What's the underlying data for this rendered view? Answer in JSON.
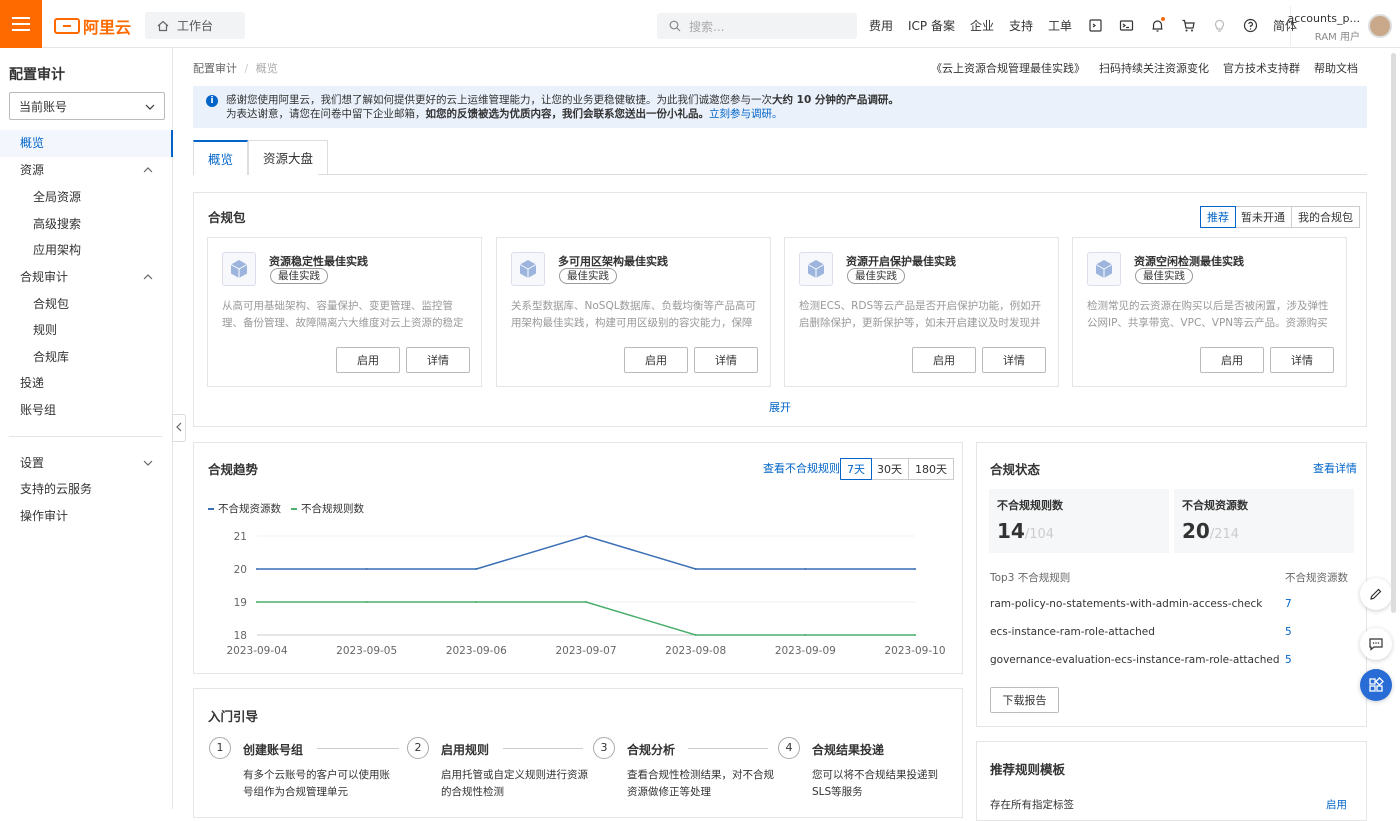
{
  "topbar": {
    "logo": "阿里云",
    "workbench": "工作台",
    "search_placeholder": "搜索...",
    "nav": [
      "费用",
      "ICP 备案",
      "企业",
      "支持",
      "工单"
    ],
    "lang": "简体",
    "account_name": "accounts_p...",
    "account_role": "RAM 用户"
  },
  "sidebar": {
    "title": "配置审计",
    "account_select": "当前账号",
    "items": [
      {
        "label": "概览"
      },
      {
        "label": "资源"
      },
      {
        "label": "全局资源"
      },
      {
        "label": "高级搜索"
      },
      {
        "label": "应用架构"
      },
      {
        "label": "合规审计"
      },
      {
        "label": "合规包"
      },
      {
        "label": "规则"
      },
      {
        "label": "合规库"
      },
      {
        "label": "投递"
      },
      {
        "label": "账号组"
      },
      {
        "label": "设置"
      },
      {
        "label": "支持的云服务"
      },
      {
        "label": "操作审计"
      }
    ]
  },
  "breadcrumb": {
    "root": "配置审计",
    "sep": "/",
    "current": "概览"
  },
  "top_links": [
    "《云上资源合规管理最佳实践》",
    "扫码持续关注资源变化",
    "官方技术支持群",
    "帮助文档"
  ],
  "banner": {
    "line1_a": "感谢您使用阿里云，我们想了解如何提供更好的云上运维管理能力，让您的业务更稳健敏捷。为此我们诚邀您参与一次",
    "line1_b": "大约 10 分钟的产品调研。",
    "line2_a": "为表达谢意，请您在问卷中留下企业邮箱，",
    "line2_b": "如您的反馈被选为优质内容，我们会联系您送出一份小礼品。",
    "line2_link": "立刻参与调研。"
  },
  "tabs": [
    "概览",
    "资源大盘"
  ],
  "compliance_packs": {
    "title": "合规包",
    "filters": [
      "推荐",
      "暂未开通",
      "我的合规包"
    ],
    "cards": [
      {
        "name": "资源稳定性最佳实践",
        "tag": "最佳实践",
        "desc": "从高可用基础架构、容量保护、变更管理、监控管理、备份管理、故障隔离六大维度对云上资源的稳定性做..."
      },
      {
        "name": "多可用区架构最佳实践",
        "tag": "最佳实践",
        "desc": "关系型数据库、NoSQL数据库、负载均衡等产品高可用架构最佳实践，构建可用区级别的容灾能力，保障服..."
      },
      {
        "name": "资源开启保护最佳实践",
        "tag": "最佳实践",
        "desc": "检测ECS、RDS等云产品是否开启保护功能，例如开启删除保护，更新保护等，如未开启建议及时发现并治..."
      },
      {
        "name": "资源空闲检测最佳实践",
        "tag": "最佳实践",
        "desc": "检测常见的云资源在购买以后是否被闲置，涉及弹性公网IP、共享带宽、VPC、VPN等云产品。资源购买后..."
      }
    ],
    "enable_label": "启用",
    "detail_label": "详情",
    "expand": "展开"
  },
  "trend": {
    "title": "合规趋势",
    "link": "查看不合规规则",
    "ranges": [
      "7天",
      "30天",
      "180天"
    ]
  },
  "chart_data": {
    "type": "line",
    "x": [
      "2023-09-04",
      "2023-09-05",
      "2023-09-06",
      "2023-09-07",
      "2023-09-08",
      "2023-09-09",
      "2023-09-10"
    ],
    "series": [
      {
        "name": "不合规资源数",
        "values": [
          20,
          20,
          20,
          21,
          20,
          20,
          20
        ],
        "color": "#3a6fb5"
      },
      {
        "name": "不合规规则数",
        "values": [
          19,
          19,
          19,
          19,
          18,
          18,
          18
        ],
        "color": "#4caf6e"
      }
    ],
    "yticks": [
      18,
      19,
      20,
      21
    ],
    "ylim": [
      18,
      21
    ],
    "grid": true,
    "legend": "top-left"
  },
  "status": {
    "title": "合规状态",
    "link": "查看详情",
    "rules_label": "不合规规则数",
    "rules_value": "14",
    "rules_total": "/104",
    "res_label": "不合规资源数",
    "res_value": "20",
    "res_total": "/214",
    "top3_label": "Top3 不合规规则",
    "top3_col": "不合规资源数",
    "top3": [
      {
        "rule": "ram-policy-no-statements-with-admin-access-check",
        "count": "7"
      },
      {
        "rule": "ecs-instance-ram-role-attached",
        "count": "5"
      },
      {
        "rule": "governance-evaluation-ecs-instance-ram-role-attached",
        "count": "5"
      }
    ],
    "download": "下载报告"
  },
  "guide": {
    "title": "入门引导",
    "steps": [
      {
        "n": "1",
        "title": "创建账号组",
        "desc": "有多个云账号的客户可以使用账号组作为合规管理单元"
      },
      {
        "n": "2",
        "title": "启用规则",
        "desc": "启用托管或自定义规则进行资源的合规性检测"
      },
      {
        "n": "3",
        "title": "合规分析",
        "desc": "查看合规性检测结果，对不合规资源做修正等处理"
      },
      {
        "n": "4",
        "title": "合规结果投递",
        "desc": "您可以将不合规结果投递到SLS等服务"
      }
    ]
  },
  "templates": {
    "title": "推荐规则模板",
    "row": "存在所有指定标签",
    "action": "启用"
  },
  "colors": {
    "brand": "#ff6a00",
    "accent": "#0064c8"
  }
}
